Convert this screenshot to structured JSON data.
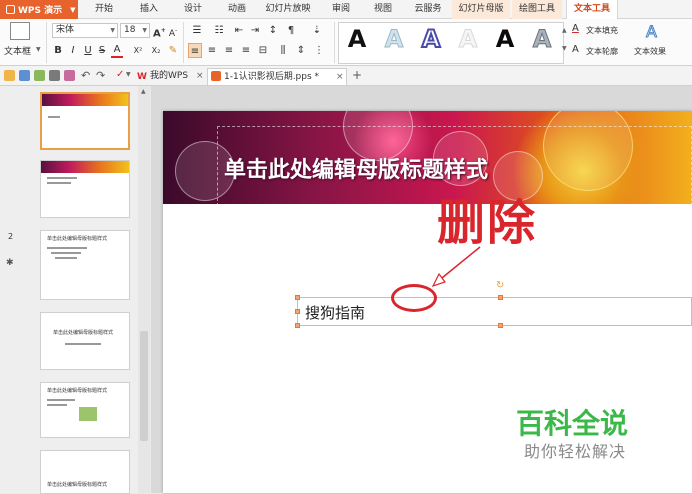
{
  "app": {
    "name": "WPS 演示"
  },
  "menu": {
    "tabs": [
      {
        "label": "开始"
      },
      {
        "label": "插入"
      },
      {
        "label": "设计"
      },
      {
        "label": "动画"
      },
      {
        "label": "幻灯片放映"
      },
      {
        "label": "审阅"
      },
      {
        "label": "视图"
      },
      {
        "label": "云服务"
      },
      {
        "label": "幻灯片母版"
      },
      {
        "label": "绘图工具"
      },
      {
        "label": "文本工具"
      }
    ],
    "active": "文本工具"
  },
  "ribbon": {
    "textbox_label": "文本框",
    "font_name": "宋体",
    "font_size": "18",
    "bold": "B",
    "italic": "I",
    "underline": "U",
    "strike": "S",
    "font_color": "A",
    "superscript": "X²",
    "subscript": "X₂",
    "style_sample": "A",
    "text_fill": "文本填充",
    "text_outline": "文本轮廓",
    "text_effect": "文本效果"
  },
  "doc_tabs": [
    {
      "label": "我的WPS"
    },
    {
      "label": "1-1认识影视后期.pps *"
    }
  ],
  "thumbnails": [
    {
      "number": "",
      "title": ""
    },
    {
      "number": "",
      "title": ""
    },
    {
      "number": "2",
      "title": "单击此处编辑母版标题样式"
    },
    {
      "number": "",
      "title": "单击此处编辑母版标题样式"
    },
    {
      "number": "",
      "title": "单击此处编辑母版标题样式"
    },
    {
      "number": "",
      "title": "单击此处编辑母版标题样式"
    }
  ],
  "slide": {
    "title": "单击此处编辑母版标题样式",
    "textbox_text": "搜狗指南",
    "annotation": "删除"
  },
  "watermark": {
    "main": "百科全说",
    "sub": "助你轻松解决"
  },
  "colors": {
    "accent": "#e8632b",
    "annotation_red": "#d9262c",
    "watermark_green": "#3cb84a"
  }
}
